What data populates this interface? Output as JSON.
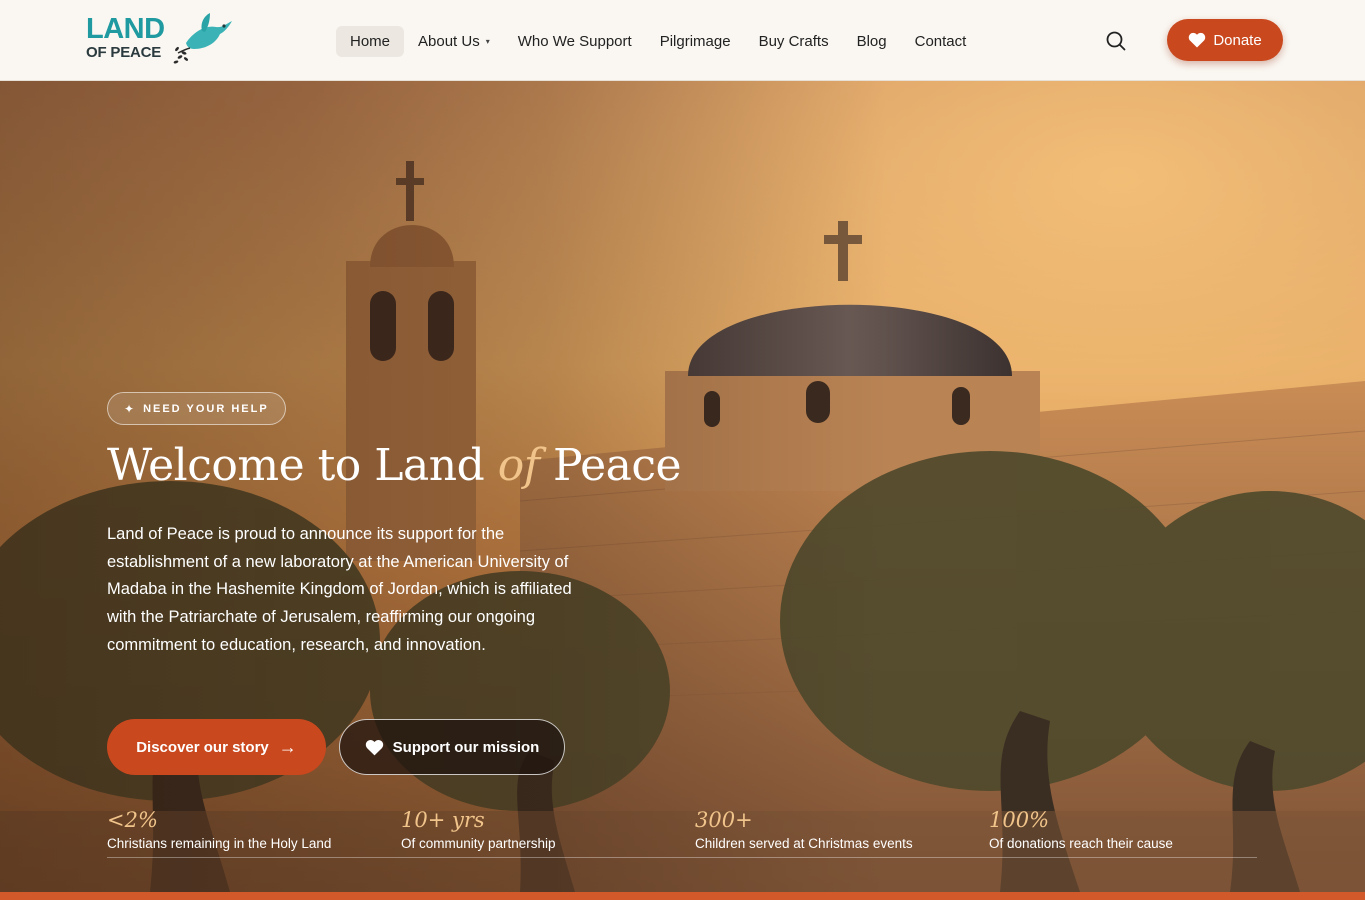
{
  "header": {
    "logo_line1": "LAND",
    "logo_line2": "OF PEACE",
    "nav": [
      {
        "label": "Home",
        "active": true
      },
      {
        "label": "About Us",
        "dropdown": true
      },
      {
        "label": "Who We Support"
      },
      {
        "label": "Pilgrimage"
      },
      {
        "label": "Buy Crafts"
      },
      {
        "label": "Blog"
      },
      {
        "label": "Contact"
      }
    ],
    "caret": "▾",
    "donate_label": "Donate"
  },
  "hero": {
    "badge": "NEED YOUR HELP",
    "badge_icon": "✦",
    "title_part1": "Welcome to Land ",
    "title_of": "of",
    "title_part2": " Peace",
    "description": "Land of Peace is proud to announce its support for the establishment of a new laboratory at the American University of Madaba in the Hashemite Kingdom of Jordan, which is affiliated with the Patriarchate of Jerusalem, reaffirming our ongoing commitment to education, research, and innovation.",
    "primary_button": "Discover our story",
    "primary_arrow": "→",
    "secondary_button": "Support our mission"
  },
  "stats": [
    {
      "value": "<2%",
      "label": "Christians remaining in the Holy Land"
    },
    {
      "value": "10+ yrs",
      "label": "Of community partnership"
    },
    {
      "value": "300+",
      "label": "Children served at Christmas events"
    },
    {
      "value": "100%",
      "label": "Of donations reach their cause"
    }
  ],
  "colors": {
    "accent": "#c9481e",
    "brand_teal": "#1f9aa0",
    "highlight_gold": "#f0c48a",
    "header_bg": "#faf7f2"
  },
  "icons": {
    "logo": "dove-icon",
    "search": "search-icon",
    "donate": "heart-icon",
    "secondary_button": "heart-icon"
  }
}
